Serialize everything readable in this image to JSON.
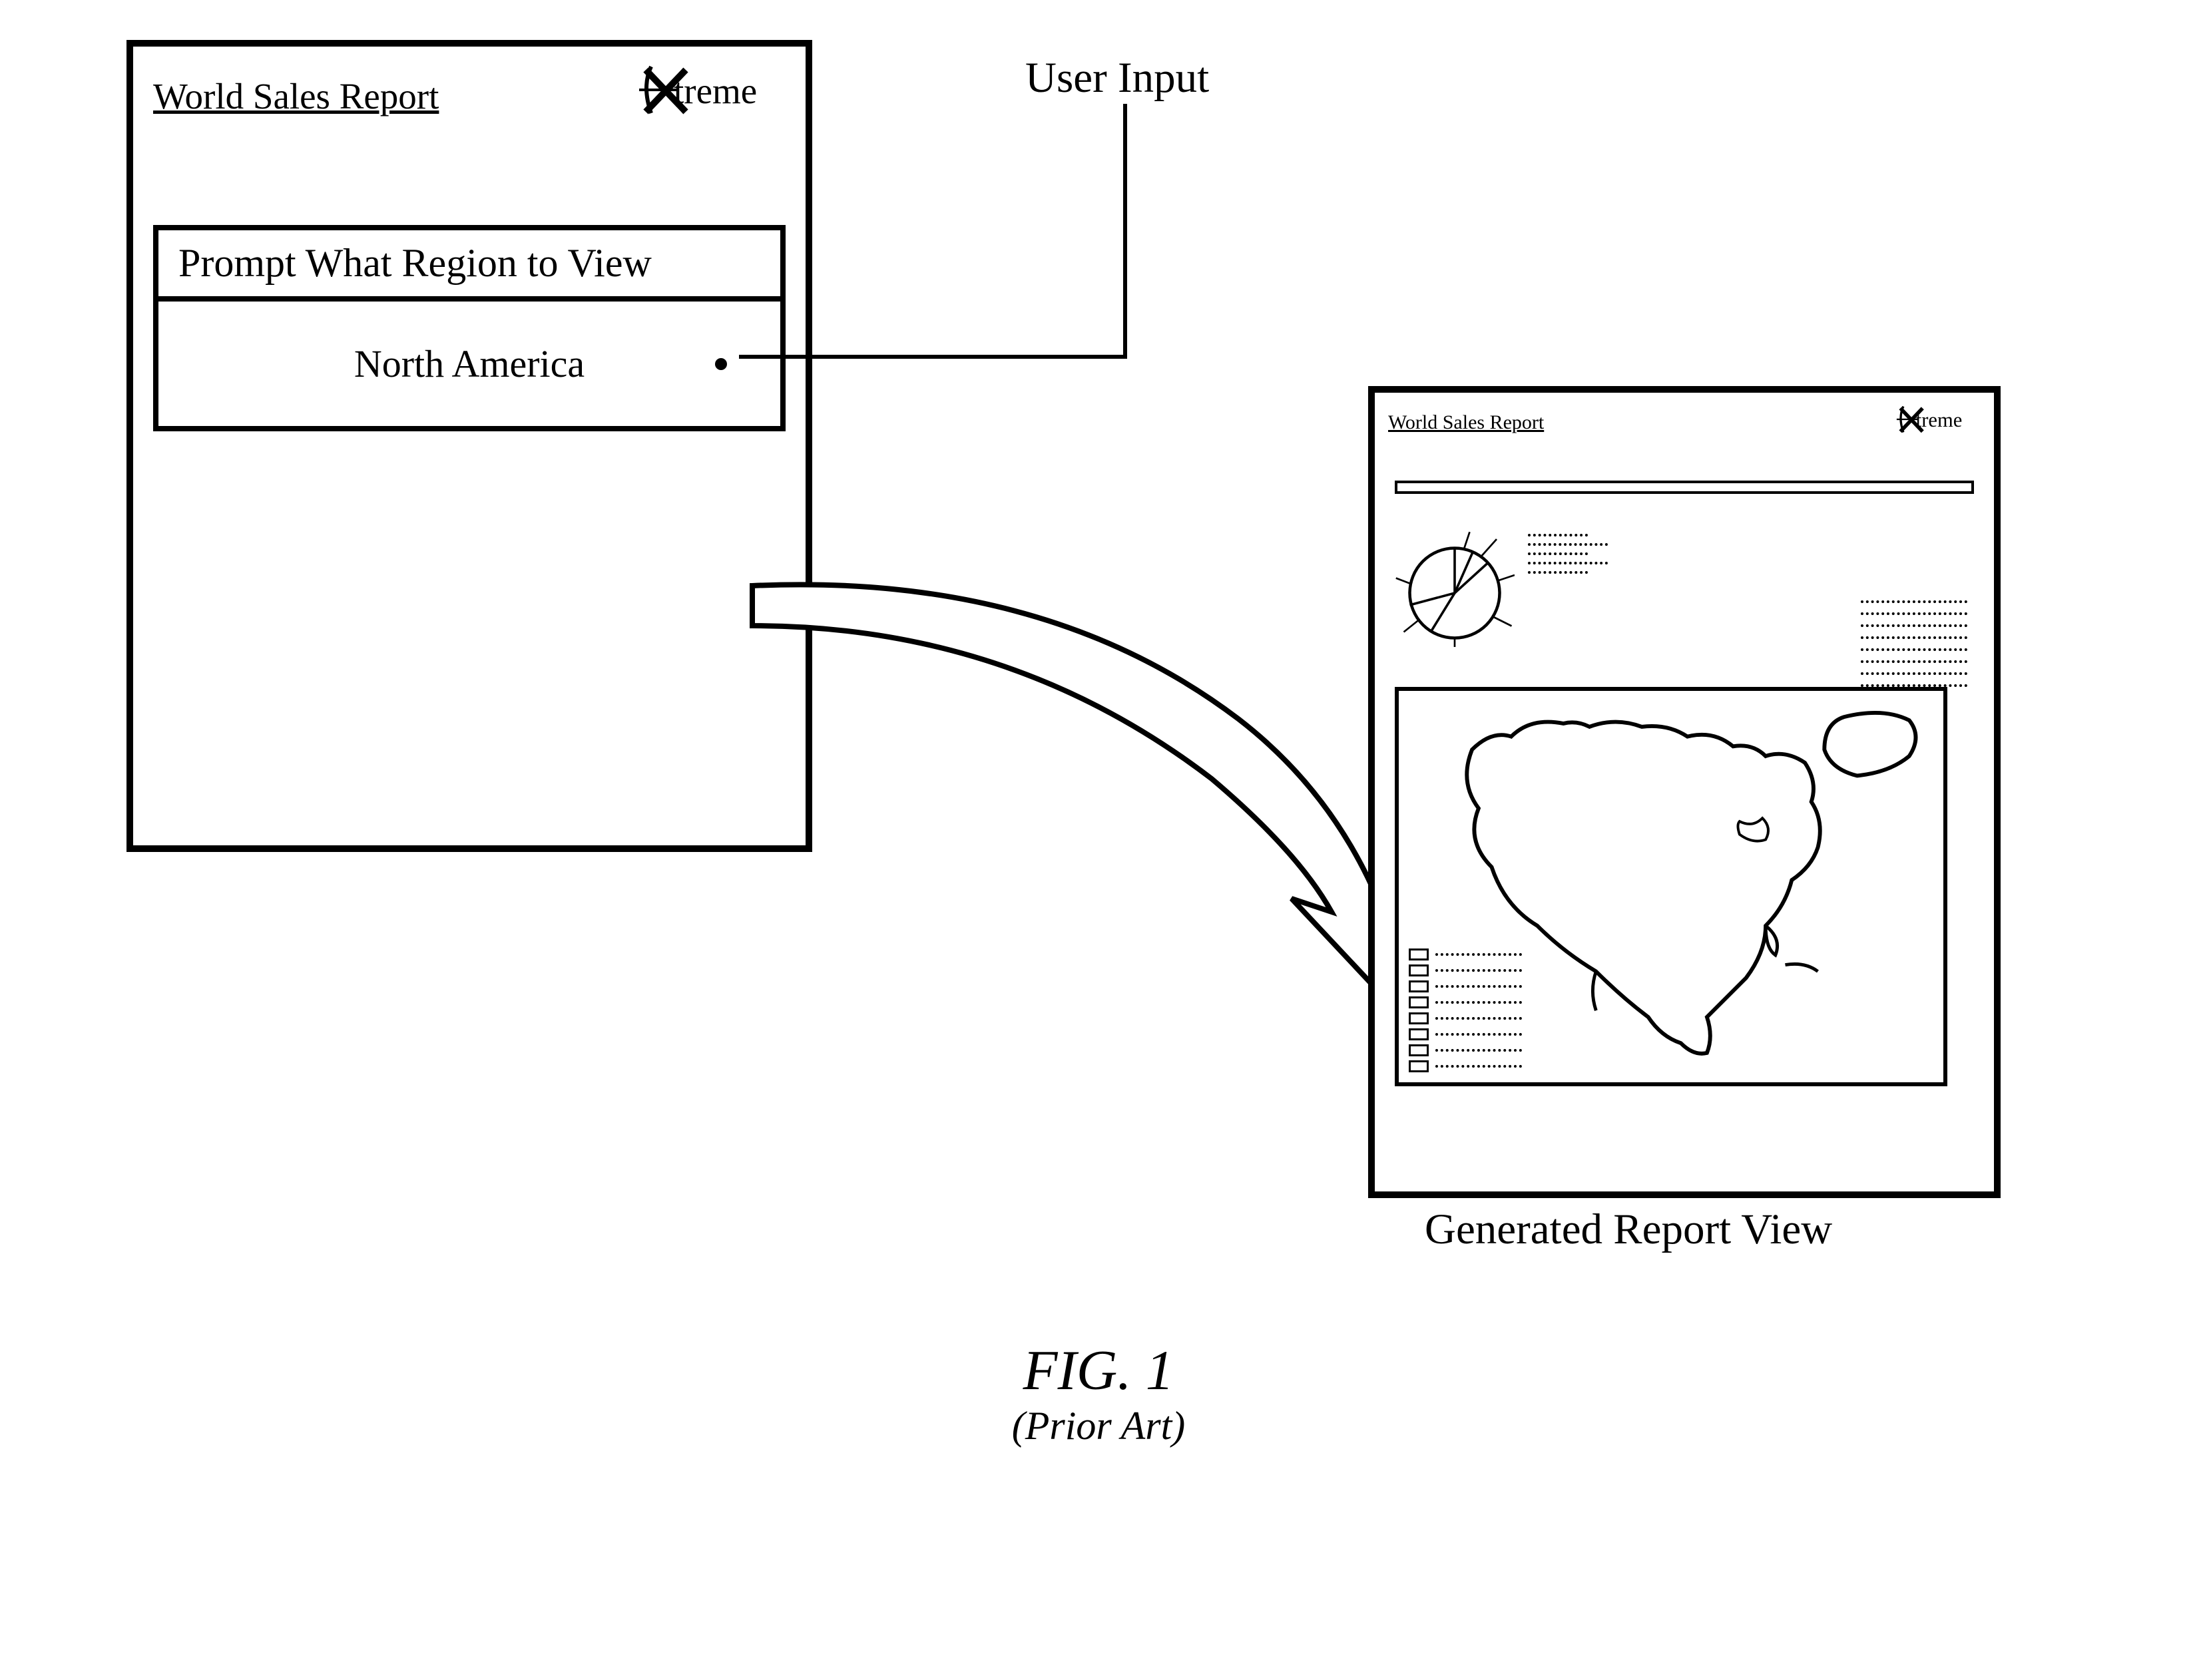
{
  "prompt_panel": {
    "title": "World Sales Report",
    "logo_text": "Xtreme",
    "prompt_header": "Prompt What Region to View",
    "prompt_value": "North America"
  },
  "annotations": {
    "user_input": "User Input",
    "generated_report": "Generated Report View"
  },
  "report_panel": {
    "title": "World Sales Report",
    "logo_text": "Xtreme"
  },
  "figure": {
    "title": "FIG. 1",
    "subtitle": "(Prior Art)"
  }
}
